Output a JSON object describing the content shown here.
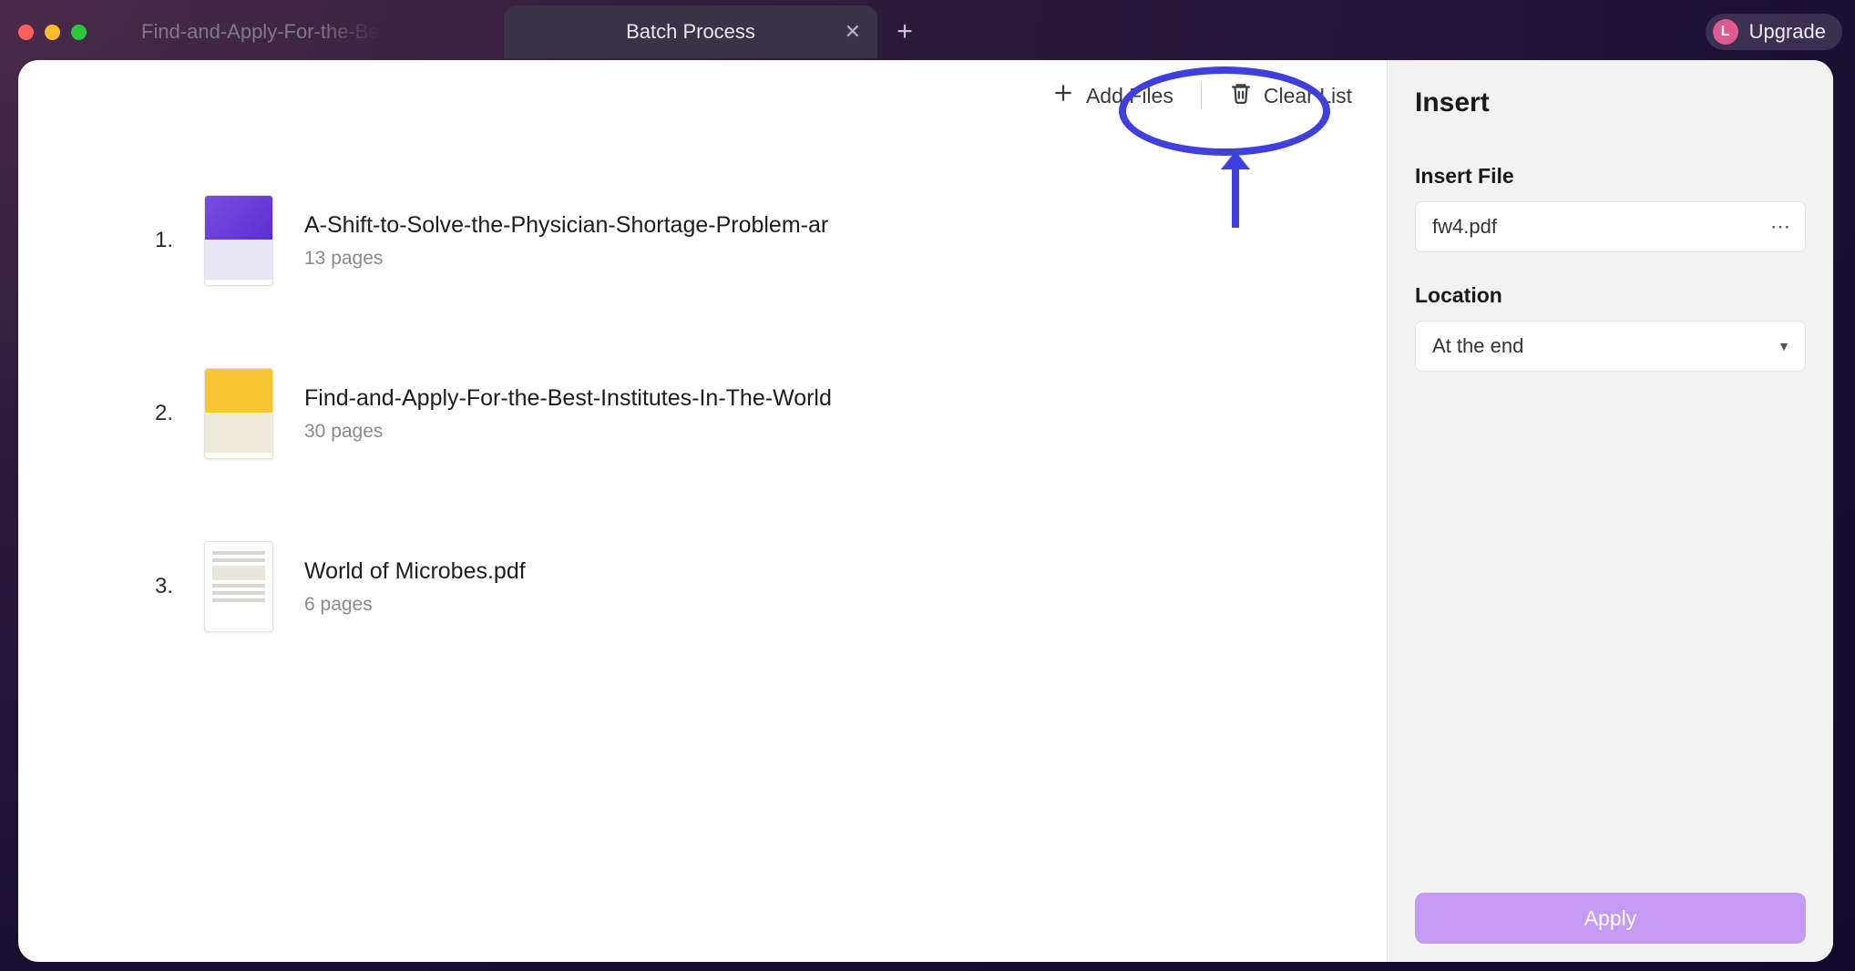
{
  "tabs": {
    "inactive": {
      "title": "Find-and-Apply-For-the-Be"
    },
    "active": {
      "title": "Batch Process"
    }
  },
  "upgrade": {
    "initial": "L",
    "label": "Upgrade"
  },
  "toolbar": {
    "add_files": "Add Files",
    "clear_list": "Clear List"
  },
  "files": [
    {
      "index": "1.",
      "name": "A-Shift-to-Solve-the-Physician-Shortage-Problem-ar",
      "pages": "13 pages"
    },
    {
      "index": "2.",
      "name": "Find-and-Apply-For-the-Best-Institutes-In-The-World",
      "pages": "30 pages"
    },
    {
      "index": "3.",
      "name": "World of Microbes.pdf",
      "pages": "6 pages"
    }
  ],
  "side": {
    "title": "Insert",
    "insert_file_label": "Insert File",
    "insert_file_value": "fw4.pdf",
    "location_label": "Location",
    "location_value": "At the end",
    "apply": "Apply"
  }
}
